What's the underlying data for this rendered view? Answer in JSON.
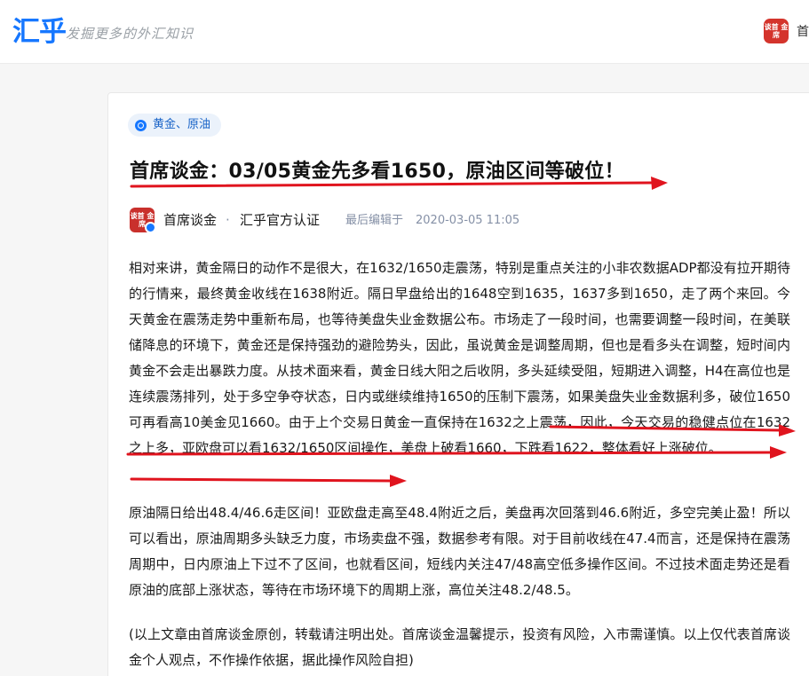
{
  "header": {
    "logo": "汇乎",
    "slogan": "发掘更多的外汇知识",
    "avatar_text": "谈首 金席",
    "nav_label": "首"
  },
  "article": {
    "tag": "黄金、原油",
    "title": "首席谈金：03/05黄金先多看1650，原油区间等破位！",
    "author": {
      "avatar_text": "谈首 金席",
      "name": "首席谈金",
      "separator": "·",
      "certification": "汇乎官方认证",
      "edit_label": "最后编辑于",
      "edit_time": "2020-03-05 11:05"
    },
    "paragraphs": [
      "相对来讲，黄金隔日的动作不是很大，在1632/1650走震荡，特别是重点关注的小非农数据ADP都没有拉开期待的行情来，最终黄金收线在1638附近。隔日早盘给出的1648空到1635，1637多到1650，走了两个来回。今天黄金在震荡走势中重新布局，也等待美盘失业金数据公布。市场走了一段时间，也需要调整一段时间，在美联储降息的环境下，黄金还是保持强劲的避险势头，因此，虽说黄金是调整周期，但也是看多头在调整，短时间内黄金不会走出暴跌力度。从技术面来看，黄金日线大阳之后收阴，多头延续受阻，短期进入调整，H4在高位也是连续震荡排列，处于多空争夺状态，日内或继续维持1650的压制下震荡，如果美盘失业金数据利多，破位1650可再看高10美金见1660。由于上个交易日黄金一直保持在1632之上震荡，因此，今天交易的稳健点位在1632之上多，亚欧盘可以看1632/1650区间操作，美盘上破看1660，下跌看1622，整体看好上涨破位。",
      "原油隔日给出48.4/46.6走区间！亚欧盘走高至48.4附近之后，美盘再次回落到46.6附近，多空完美止盈！所以可以看出，原油周期多头缺乏力度，市场卖盘不强，数据参考有限。对于目前收线在47.4而言，还是保持在震荡周期中，日内原油上下过不了区间，也就看区间，短线内关注47/48高空低多操作区间。不过技术面走势还是看原油的底部上涨状态，等待在市场环境下的周期上涨，高位关注48.2/48.5。",
      "(以上文章由首席谈金原创，转载请注明出处。首席谈金温馨提示，投资有风险，入市需谨慎。以上仅代表首席谈金个人观点，不作操作依据，据此操作风险自担)"
    ]
  },
  "colors": {
    "brand_blue": "#1677ff",
    "annotation_red": "#e0141e",
    "avatar_red": "#c9302c"
  }
}
